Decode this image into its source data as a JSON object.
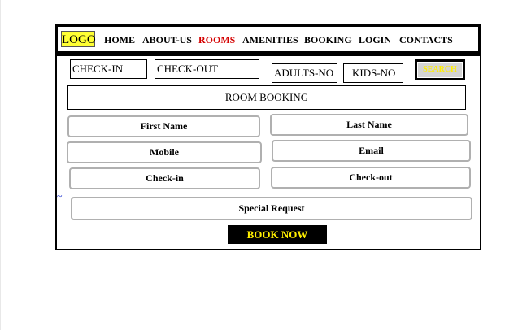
{
  "nav": {
    "logo": "LOGO",
    "links": [
      "HOME",
      "ABOUT-US",
      "ROOMS",
      "AMENITIES",
      "BOOKING",
      "LOGIN",
      "CONTACTS"
    ],
    "active": "ROOMS"
  },
  "search": {
    "check_in": "CHECK-IN",
    "check_out": "CHECK-OUT",
    "adults": "ADULTS-NO",
    "kids": "KIDS-NO",
    "button": "SEARCH"
  },
  "booking": {
    "title": "ROOM BOOKING",
    "first_name": "First Name",
    "last_name": "Last Name",
    "mobile": "Mobile",
    "email": "Email",
    "check_in": "Check-in",
    "check_out": "Check-out",
    "special_request": "Special Request",
    "submit": "BOOK NOW"
  },
  "colors": {
    "logo_bg": "#ffff33",
    "active_link": "#d40000",
    "button_text": "#ffee00",
    "search_bg": "#d4d4d4"
  }
}
